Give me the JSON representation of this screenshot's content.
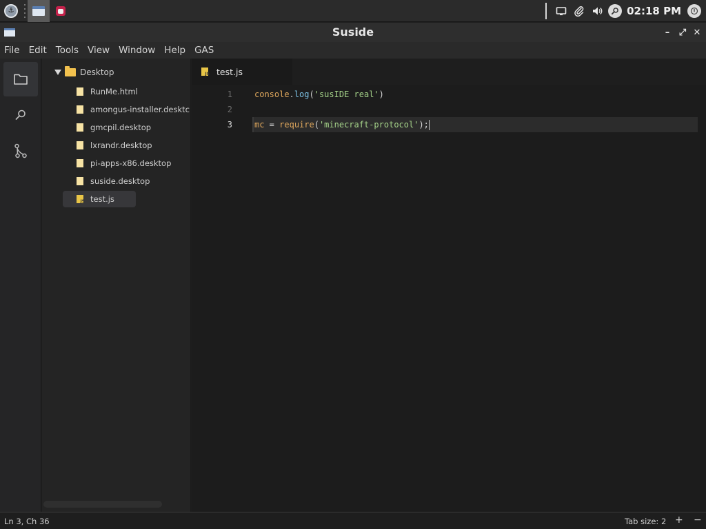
{
  "taskbar": {
    "clock": "02:18 PM",
    "icons": [
      "start-menu-icon",
      "window-icon",
      "raspberry-icon",
      "screen-icon",
      "paperclip-icon",
      "volume-icon",
      "search-icon",
      "power-icon"
    ]
  },
  "window": {
    "title": "Suside",
    "controls": {
      "minimize": "–",
      "maximize": "⤢",
      "close": "✕"
    }
  },
  "menu": [
    "File",
    "Edit",
    "Tools",
    "View",
    "Window",
    "Help",
    "GAS"
  ],
  "explorer": {
    "root": "Desktop",
    "files": [
      {
        "name": "RunMe.html",
        "type": "file"
      },
      {
        "name": "amongus-installer.desktc",
        "type": "file"
      },
      {
        "name": "gmcpil.desktop",
        "type": "file"
      },
      {
        "name": "lxrandr.desktop",
        "type": "file"
      },
      {
        "name": "pi-apps-x86.desktop",
        "type": "file"
      },
      {
        "name": "suside.desktop",
        "type": "file"
      },
      {
        "name": "test.js",
        "type": "js",
        "selected": true
      }
    ]
  },
  "editor": {
    "tab": "test.js",
    "line_numbers": [
      "1",
      "2",
      "3"
    ],
    "current_line": 3,
    "lines": [
      {
        "tokens": [
          {
            "t": "console",
            "c": "id"
          },
          {
            "t": ".",
            "c": "punct"
          },
          {
            "t": "log",
            "c": "fn"
          },
          {
            "t": "(",
            "c": "punct"
          },
          {
            "t": "'susIDE real'",
            "c": "str"
          },
          {
            "t": ")",
            "c": "punct"
          }
        ]
      },
      {
        "tokens": []
      },
      {
        "tokens": [
          {
            "t": "mc",
            "c": "id"
          },
          {
            "t": " = ",
            "c": "punct"
          },
          {
            "t": "require",
            "c": "id"
          },
          {
            "t": "(",
            "c": "punct"
          },
          {
            "t": "'minecraft-protocol'",
            "c": "str"
          },
          {
            "t": ");",
            "c": "punct"
          }
        ]
      }
    ]
  },
  "status": {
    "position": "Ln 3, Ch 36",
    "tab_size": "Tab size: 2",
    "plus": "+",
    "minus": "−"
  }
}
